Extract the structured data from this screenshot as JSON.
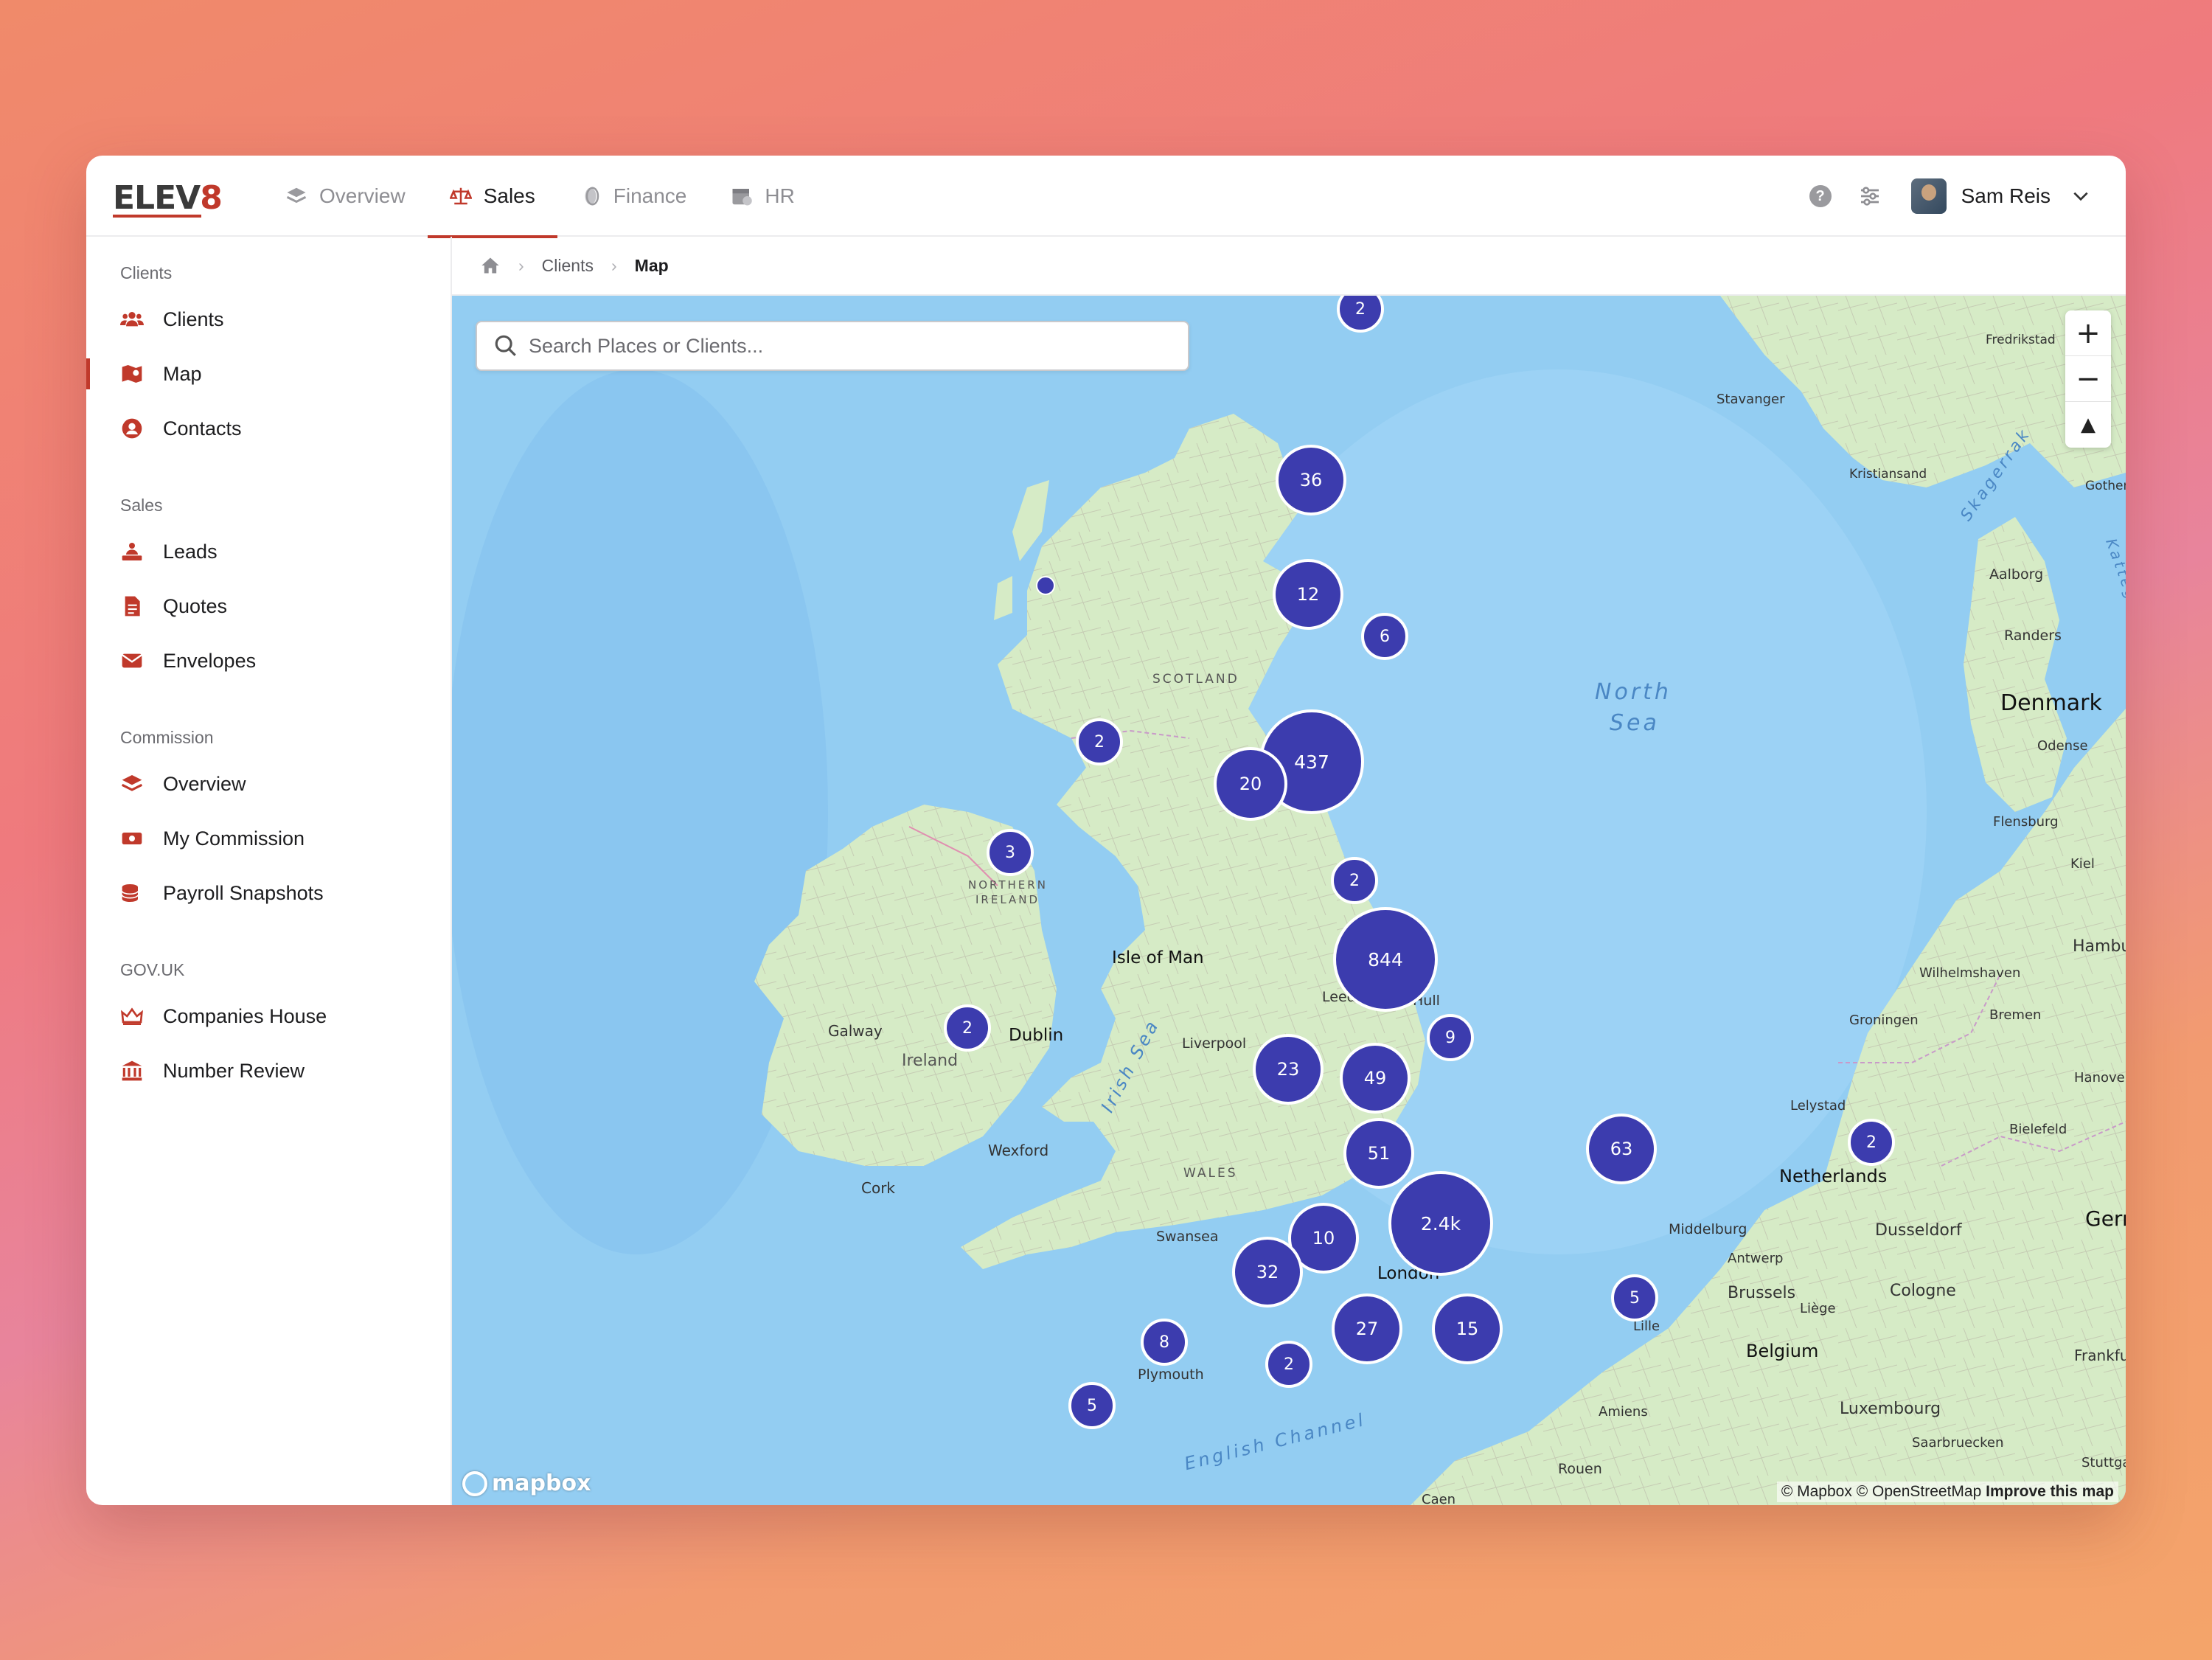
{
  "brand": {
    "logo_text_a": "ELEV",
    "logo_text_b": "8"
  },
  "nav": [
    {
      "label": "Overview",
      "icon": "layers-icon"
    },
    {
      "label": "Sales",
      "icon": "scale-icon"
    },
    {
      "label": "Finance",
      "icon": "coins-icon"
    },
    {
      "label": "HR",
      "icon": "calendar-user-icon"
    }
  ],
  "user": {
    "name": "Sam Reis"
  },
  "sidebar": {
    "sections": [
      {
        "title": "Clients",
        "items": [
          {
            "label": "Clients",
            "icon": "users-icon"
          },
          {
            "label": "Map",
            "icon": "map-icon"
          },
          {
            "label": "Contacts",
            "icon": "user-circle-icon"
          }
        ]
      },
      {
        "title": "Sales",
        "items": [
          {
            "label": "Leads",
            "icon": "leads-icon"
          },
          {
            "label": "Quotes",
            "icon": "document-icon"
          },
          {
            "label": "Envelopes",
            "icon": "envelope-icon"
          }
        ]
      },
      {
        "title": "Commission",
        "items": [
          {
            "label": "Overview",
            "icon": "layers-icon"
          },
          {
            "label": "My Commission",
            "icon": "money-icon"
          },
          {
            "label": "Payroll Snapshots",
            "icon": "coins-stack-icon"
          }
        ]
      },
      {
        "title": "GOV.UK",
        "items": [
          {
            "label": "Companies House",
            "icon": "crown-icon"
          },
          {
            "label": "Number Review",
            "icon": "bank-icon"
          }
        ]
      }
    ]
  },
  "breadcrumb": {
    "items": [
      "Clients",
      "Map"
    ]
  },
  "search": {
    "placeholder": "Search Places or Clients..."
  },
  "map": {
    "clusters": [
      "2",
      "36",
      "12",
      "6",
      "2",
      "437",
      "20",
      "3",
      "2",
      "844",
      "2",
      "9",
      "23",
      "49",
      "63",
      "51",
      "2.4k",
      "10",
      "32",
      "5",
      "27",
      "15",
      "8",
      "2",
      "5",
      "2"
    ],
    "labels": {
      "scotland": "SCOTLAND",
      "northern_ireland_1": "NORTHERN",
      "northern_ireland_2": "IRELAND",
      "isle_of_man": "Isle of Man",
      "galway": "Galway",
      "ireland": "Ireland",
      "dublin": "Dublin",
      "wexford": "Wexford",
      "cork": "Cork",
      "irish_sea": "Irish Sea",
      "liverpool": "Liverpool",
      "leeds": "Leeds",
      "hull": "Hull",
      "wales": "WALES",
      "swansea": "Swansea",
      "plymouth": "Plymouth",
      "london": "London",
      "english_channel": "English Channel",
      "north_sea_1": "North",
      "north_sea_2": "Sea",
      "stavanger": "Stavanger",
      "kristiansand": "Kristiansand",
      "fredrikstad": "Fredrikstad",
      "skagerrak": "Skagerrak",
      "gothenburg": "Gothenb",
      "kattegat": "Katteg",
      "aalborg": "Aalborg",
      "randers": "Randers",
      "denmark": "Denmark",
      "odense": "Odense",
      "flensburg": "Flensburg",
      "kiel": "Kiel",
      "hamburg": "Hamburg",
      "wilhelmshaven": "Wilhelmshaven",
      "groningen": "Groningen",
      "bremen": "Bremen",
      "hanover": "Hanover",
      "lelystad": "Lelystad",
      "netherlands": "Netherlands",
      "bielefeld": "Bielefeld",
      "middelburg": "Middelburg",
      "dusseldorf": "Dusseldorf",
      "germany": "Gerr",
      "antwerp": "Antwerp",
      "brussels": "Brussels",
      "cologne": "Cologne",
      "lille": "Lille",
      "liege": "Liège",
      "belgium": "Belgium",
      "frankfurt": "Frankfu",
      "amiens": "Amiens",
      "luxembourg": "Luxembourg",
      "saarbruecken": "Saarbruecken",
      "stuttgart": "Stuttga",
      "rouen": "Rouen",
      "caen": "Caen"
    },
    "attribution": {
      "mapbox": "© Mapbox",
      "osm": "© OpenStreetMap",
      "improve": "Improve this map"
    },
    "logo": "mapbox",
    "controls": {
      "zoom_in": "+",
      "zoom_out": "−",
      "compass": "▲"
    }
  }
}
